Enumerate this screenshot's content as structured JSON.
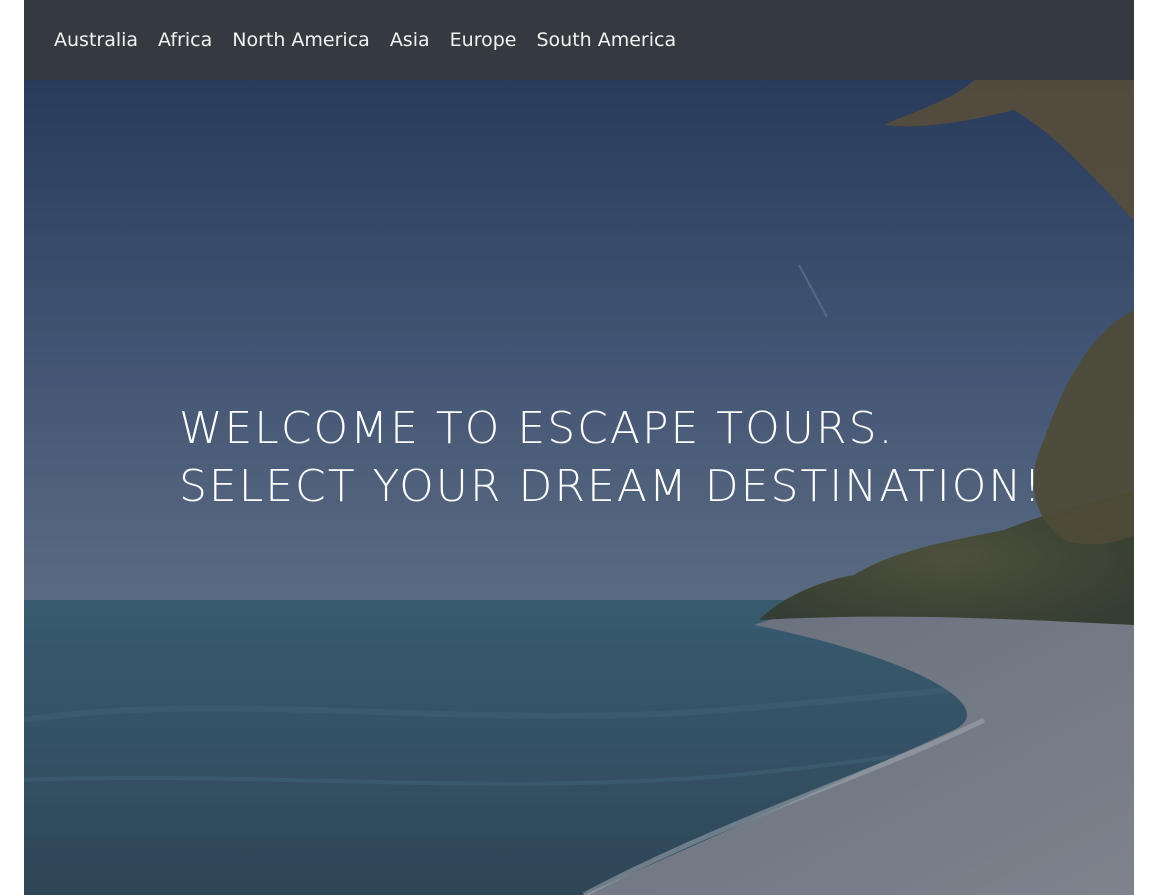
{
  "nav": {
    "items": [
      {
        "label": "Australia"
      },
      {
        "label": "Africa"
      },
      {
        "label": "North America"
      },
      {
        "label": "Asia"
      },
      {
        "label": "Europe"
      },
      {
        "label": "South America"
      }
    ]
  },
  "hero": {
    "line1": "WELCOME TO ESCAPE TOURS.",
    "line2": "SELECT YOUR DREAM DESTINATION!"
  },
  "colors": {
    "navbar": "#343a40",
    "nav_text": "#f2f2f2",
    "sky_top": "#2f4567",
    "sky_bottom": "#6a7d97",
    "sea": "#3b5f73",
    "sand": "#8a909c"
  }
}
